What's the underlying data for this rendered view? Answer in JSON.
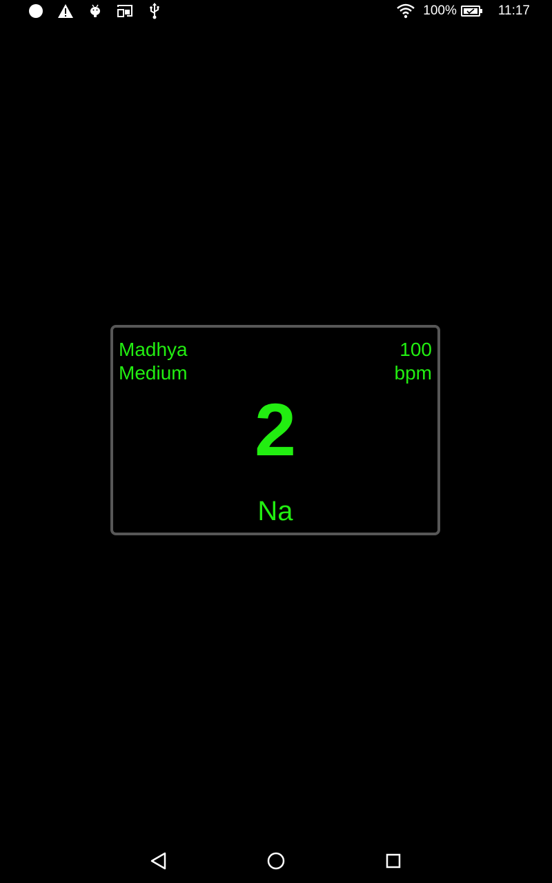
{
  "status_bar": {
    "left_icons": [
      "circle-notification-icon",
      "warning-icon",
      "android-debug-icon",
      "cast-screen-icon",
      "usb-icon"
    ],
    "battery_percent": "100%",
    "time": "11:17",
    "icons_right": [
      "wifi-icon",
      "battery-charging-icon"
    ]
  },
  "metronome": {
    "tempo_name": "Madhya",
    "tempo_name_english": "Medium",
    "bpm_value": "100",
    "bpm_unit": "bpm",
    "beat_number": "2",
    "syllable": "Na",
    "accent_color": "#22ee11",
    "border_color": "#575757"
  },
  "nav_bar": {
    "buttons": [
      "back-icon",
      "home-icon",
      "recents-icon"
    ]
  }
}
